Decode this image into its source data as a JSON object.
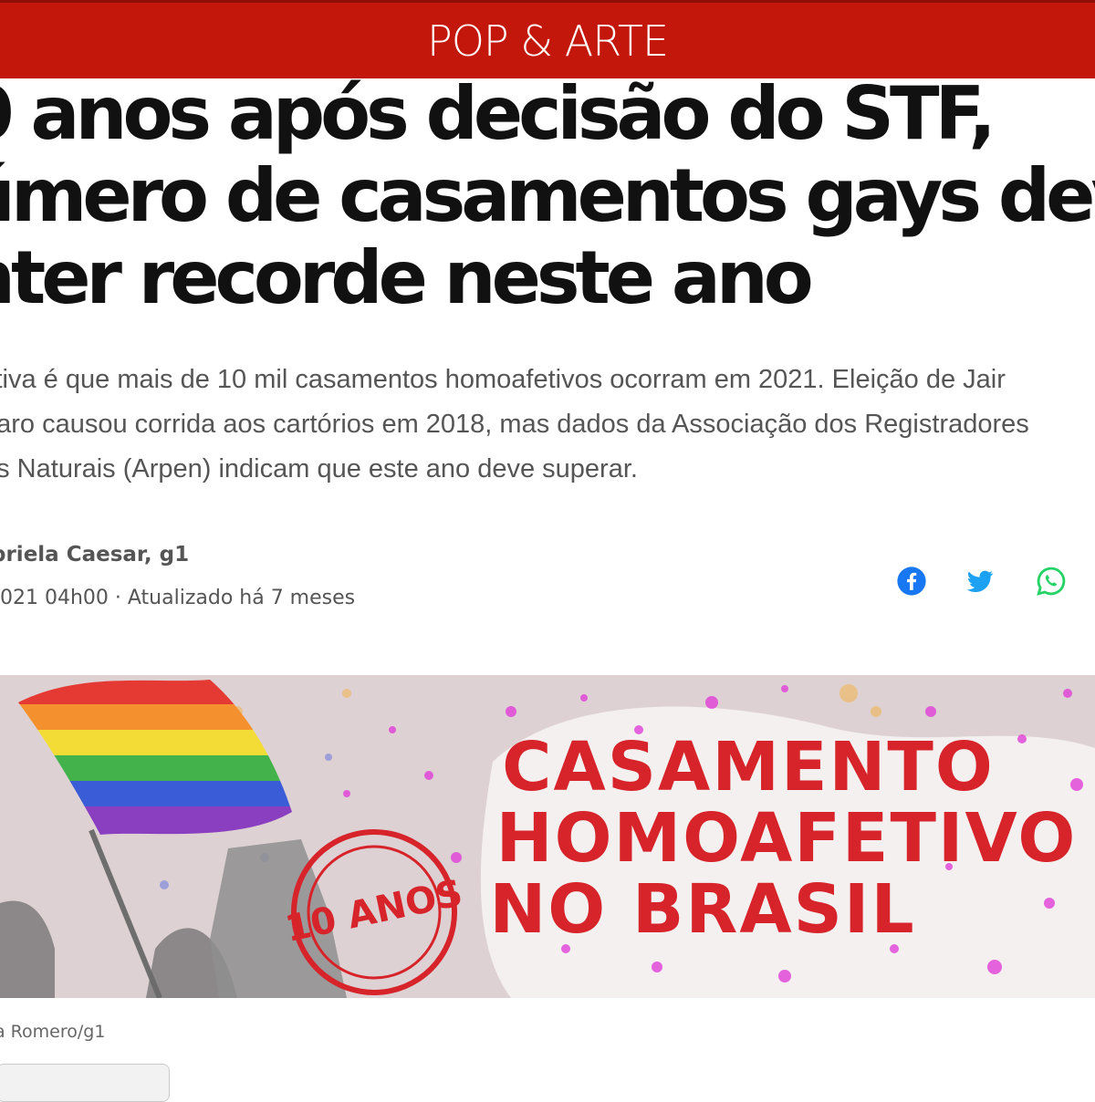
{
  "section": {
    "label": "POP & ARTE"
  },
  "headline": {
    "lines": [
      "0 anos após decisão do STF,",
      "úmero de casamentos gays dev",
      "nter recorde neste ano"
    ]
  },
  "subtitle": {
    "lines": [
      "ctiva é que mais de 10 mil casamentos homoafetivos ocorram em 2021. Eleição de Jair",
      "naro causou corrida aos cartórios em 2018, mas dados da Associação dos Registradores",
      "as Naturais (Arpen) indicam que este ano deve superar."
    ]
  },
  "byline": {
    "author": "briela Caesar, g1",
    "date": "2021 04h00 · Atualizado há 7 meses"
  },
  "share": {
    "icons": [
      "facebook-icon",
      "twitter-icon",
      "whatsapp-icon"
    ],
    "colors": {
      "facebook": "#1877f2",
      "twitter": "#1da1f2",
      "whatsapp": "#25d366"
    }
  },
  "hero": {
    "badge": "10 ANOS",
    "title_lines": [
      "CASAMENTO",
      "HOMOAFETIVO",
      "NO BRASIL"
    ],
    "accent": "#d6242a"
  },
  "caption": {
    "credit": "a Romero/g1"
  },
  "colors": {
    "section_bar": "#c4170c",
    "text": "#111111",
    "muted": "#555555"
  }
}
